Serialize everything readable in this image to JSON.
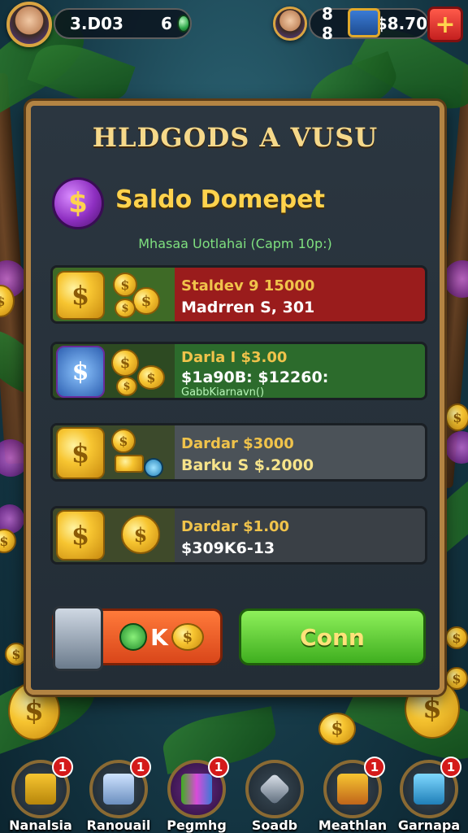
{
  "topbar": {
    "left_currency": "3.D03",
    "left_gems": "6",
    "right_count": "8 8",
    "right_currency": "$8.70",
    "plus_label": "+"
  },
  "panel": {
    "title": "HLDGODS A VUSU",
    "subtitle": "Saldo Domepet",
    "info": "Mhasaa Uotlahai (Capm 10p:)",
    "rows": [
      {
        "line1": "Staldev 9 15000",
        "line2": "Madrren S, 301",
        "line3": ""
      },
      {
        "line1": "Darla I $3.00",
        "line2": "$1a90B: $12260:",
        "line3": "GabbKiarnavn()"
      },
      {
        "line1": "Dardar $3000",
        "line2": "Barku S $.2000",
        "line3": ""
      },
      {
        "line1": "Dardar $1.00",
        "line2": "$309K6-13",
        "line3": ""
      }
    ],
    "btn_left_label": "K",
    "btn_right_label": "Conn"
  },
  "nav": [
    {
      "label": "Nanalsia",
      "badge": "1",
      "icon": "building-icon"
    },
    {
      "label": "Ranouail",
      "badge": "1",
      "icon": "box-icon"
    },
    {
      "label": "Pegmhg",
      "badge": "1",
      "icon": "gift-icon"
    },
    {
      "label": "Soadb",
      "badge": "",
      "icon": "sword-icon"
    },
    {
      "label": "Meathlan",
      "badge": "1",
      "icon": "chest-icon"
    },
    {
      "label": "Garnapa",
      "badge": "1",
      "icon": "tablet-icon"
    }
  ],
  "colors": {
    "panel_border": "#b38443",
    "title": "#f6d98a",
    "row1": "#9a1c1c",
    "row2": "#2c6b2c",
    "row3": "#4b5258",
    "row4": "#3a4046",
    "confirm": "#5bd12b",
    "cancel": "#e25a26"
  }
}
